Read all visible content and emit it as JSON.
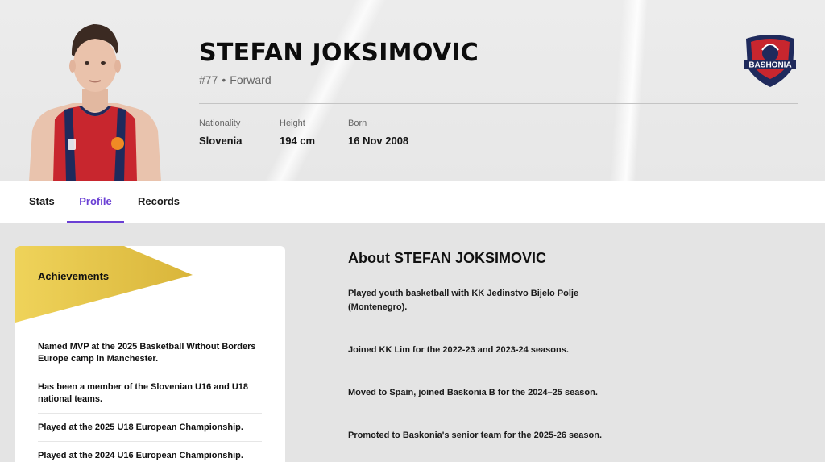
{
  "player": {
    "name": "STEFAN JOKSIMOVIC",
    "number": "#77",
    "separator": "•",
    "position": "Forward"
  },
  "stats": [
    {
      "label": "Nationality",
      "value": "Slovenia"
    },
    {
      "label": "Height",
      "value": "194 cm"
    },
    {
      "label": "Born",
      "value": "16 Nov 2008"
    }
  ],
  "club_logo": {
    "icon": "bashonia-crest-icon",
    "text": "BASHONIA"
  },
  "tabs": [
    {
      "label": "Stats",
      "active": false
    },
    {
      "label": "Profile",
      "active": true
    },
    {
      "label": "Records",
      "active": false
    }
  ],
  "achievements": {
    "title": "Achievements",
    "items": [
      "Named MVP at the 2025 Basketball Without Borders Europe camp in Manchester.",
      "Has been a member of the Slovenian U16 and U18 national teams.",
      "Played at the 2025 U18 European Championship.",
      "Played at the 2024 U16 European Championship."
    ]
  },
  "about": {
    "title": "About STEFAN JOKSIMOVIC",
    "paragraphs": [
      "Played youth basketball with KK Jedinstvo Bijelo Polje (Montenegro).",
      "Joined KK Lim for the 2022-23 and 2023-24 seasons.",
      "Moved to Spain, joined Baskonia B for the 2024–25 season.",
      "Promoted to Baskonia's senior team for the 2025-26 season."
    ]
  },
  "colors": {
    "accent": "#6a3fd4",
    "banner_gold": "#e8c84a",
    "jersey_red": "#c8262e",
    "jersey_navy": "#1f2a5c"
  }
}
